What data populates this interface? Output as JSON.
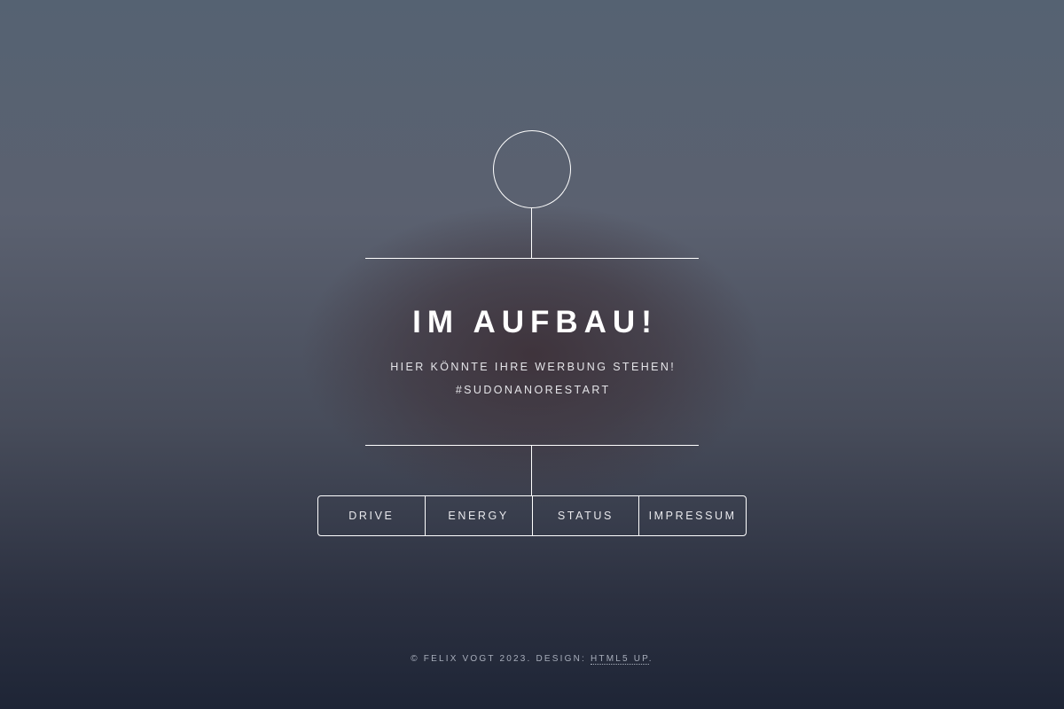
{
  "header": {
    "title": "IM AUFBAU!",
    "subtitle_line1": "HIER KÖNNTE IHRE WERBUNG STEHEN!",
    "subtitle_line2": "#SUDONANORESTART"
  },
  "nav": {
    "items": [
      {
        "label": "DRIVE"
      },
      {
        "label": "ENERGY"
      },
      {
        "label": "STATUS"
      },
      {
        "label": "IMPRESSUM"
      }
    ]
  },
  "footer": {
    "copyright": "© FELIX VOGT 2023. DESIGN:",
    "design_link": "HTML5 UP",
    "suffix": "."
  },
  "colors": {
    "line": "#ffffff",
    "background_top": "#556272",
    "background_bottom": "#1e2536"
  }
}
